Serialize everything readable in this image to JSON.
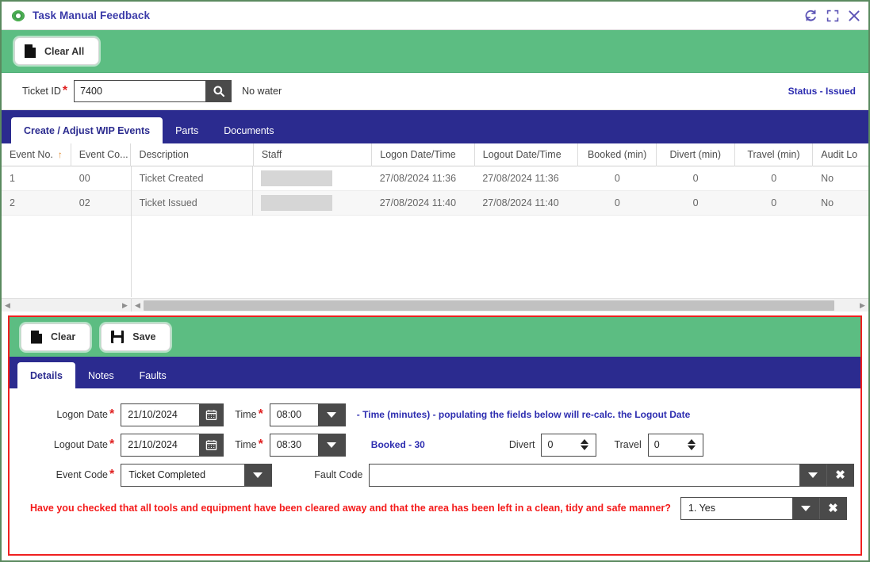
{
  "window": {
    "title": "Task Manual Feedback",
    "icons": {
      "refresh": "refresh-icon",
      "expand": "expand-icon",
      "close": "close-icon"
    }
  },
  "toolbar": {
    "clear_all_label": "Clear All"
  },
  "ticket": {
    "label": "Ticket ID",
    "required_mark": "*",
    "value": "7400",
    "placeholder": "",
    "search_icon": "search-icon",
    "description": "No water",
    "status": "Status -  Issued"
  },
  "tabs": {
    "items": [
      {
        "label": "Create / Adjust WIP Events",
        "active": true
      },
      {
        "label": "Parts",
        "active": false
      },
      {
        "label": "Documents",
        "active": false
      }
    ]
  },
  "grid": {
    "columns": [
      "Event No.",
      "Event Co...",
      "Description",
      "Staff",
      "Logon Date/Time",
      "Logout Date/Time",
      "Booked (min)",
      "Divert (min)",
      "Travel (min)",
      "Audit Lo"
    ],
    "sort_column": "Event No.",
    "sort_direction": "asc",
    "rows": [
      {
        "event_no": "1",
        "event_code": "00",
        "description": "Ticket Created",
        "staff": "",
        "logon": "27/08/2024 11:36",
        "logout": "27/08/2024 11:36",
        "booked": "0",
        "divert": "0",
        "travel": "0",
        "audit": "No"
      },
      {
        "event_no": "2",
        "event_code": "02",
        "description": "Ticket Issued",
        "staff": "",
        "logon": "27/08/2024 11:40",
        "logout": "27/08/2024 11:40",
        "booked": "0",
        "divert": "0",
        "travel": "0",
        "audit": "No"
      }
    ]
  },
  "detail_toolbar": {
    "clear_label": "Clear",
    "save_label": "Save"
  },
  "detail_tabs": {
    "items": [
      {
        "label": "Details",
        "active": true
      },
      {
        "label": "Notes",
        "active": false
      },
      {
        "label": "Faults",
        "active": false
      }
    ]
  },
  "details": {
    "logon_date_label": "Logon Date",
    "logon_date_value": "21/10/2024",
    "logon_time_label": "Time",
    "logon_time_value": "08:00",
    "hint": "- Time (minutes) - populating the fields below will re-calc. the Logout Date",
    "logout_date_label": "Logout Date",
    "logout_date_value": "21/10/2024",
    "logout_time_label": "Time",
    "logout_time_value": "08:30",
    "booked_label": "Booked -  30",
    "divert_label": "Divert",
    "divert_value": "0",
    "travel_label": "Travel",
    "travel_value": "0",
    "event_code_label": "Event Code",
    "event_code_value": "Ticket Completed",
    "fault_code_label": "Fault Code",
    "fault_code_value": "",
    "question": "Have you checked that all tools and equipment have been cleared away and that the area has been left in a clean, tidy and safe manner?",
    "answer_value": "1. Yes",
    "required_mark": "*"
  },
  "colors": {
    "green": "#5cbd82",
    "navy": "#2b2b8f",
    "red_outline": "#ef2020",
    "question_red": "#f41b1b",
    "dark_control": "#4a4a4a",
    "sort_orange": "#e08a2e"
  }
}
